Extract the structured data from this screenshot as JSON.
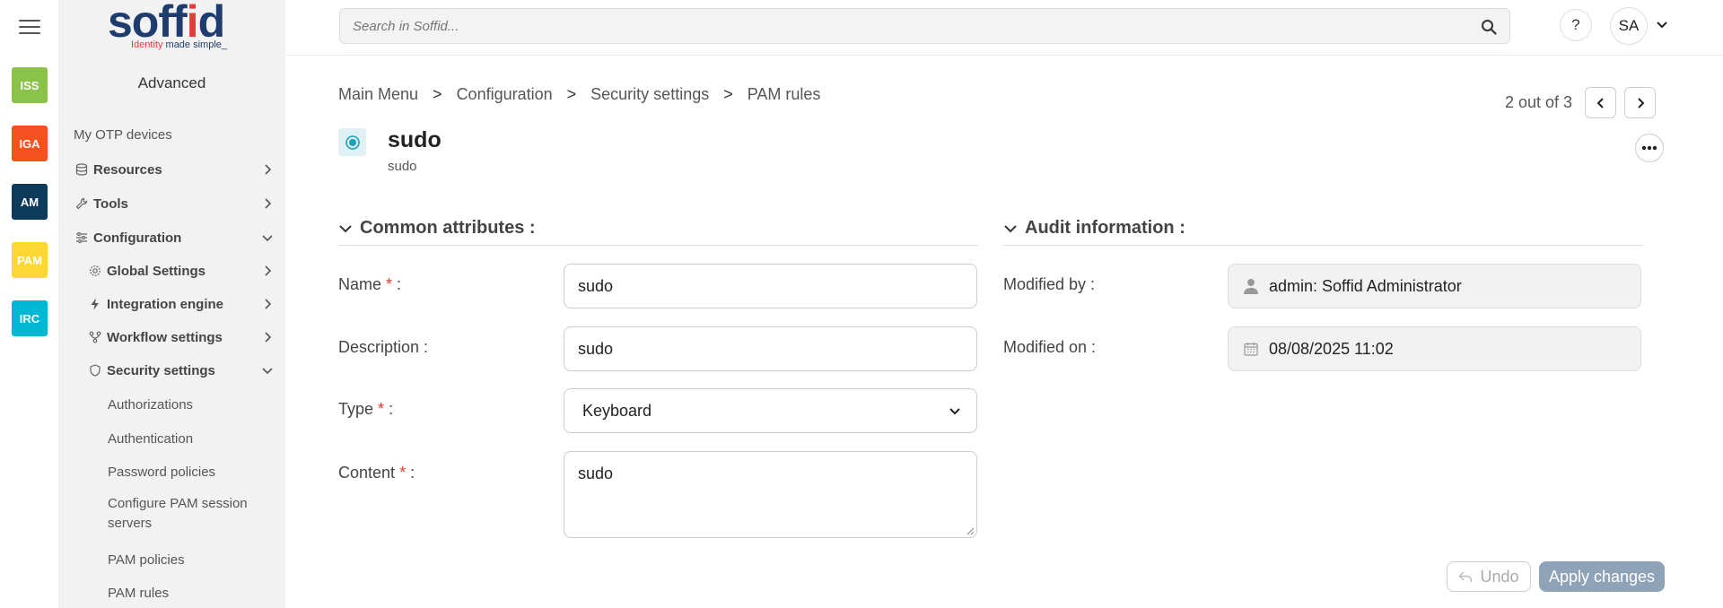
{
  "rail": {
    "tiles": [
      {
        "label": "ISS",
        "color": "#8bc34a"
      },
      {
        "label": "IGA",
        "color": "#f4511e"
      },
      {
        "label": "AM",
        "color": "#0d3b5e"
      },
      {
        "label": "PAM",
        "color": "#fdd835"
      },
      {
        "label": "IRC",
        "color": "#00b8d4"
      }
    ]
  },
  "logo": {
    "word_pre": "soff",
    "word_i": "i",
    "word_post": "d",
    "tag_pre": "Identity ",
    "tag_post": "made simple_"
  },
  "sidenav": {
    "section_title": "Advanced",
    "items": [
      {
        "label": "My OTP devices"
      },
      {
        "label": "Resources"
      },
      {
        "label": "Tools"
      },
      {
        "label": "Configuration"
      },
      {
        "label": "Global Settings"
      },
      {
        "label": "Integration engine"
      },
      {
        "label": "Workflow settings"
      },
      {
        "label": "Security settings"
      },
      {
        "label": "Authorizations"
      },
      {
        "label": "Authentication"
      },
      {
        "label": "Password policies"
      },
      {
        "label": "Configure PAM session servers"
      },
      {
        "label": "PAM policies"
      },
      {
        "label": "PAM rules"
      }
    ]
  },
  "topbar": {
    "search_placeholder": "Search in Soffid...",
    "help_label": "?",
    "avatar_initials": "SA"
  },
  "breadcrumb": {
    "items": [
      "Main Menu",
      "Configuration",
      "Security settings",
      "PAM rules"
    ],
    "separator": ">"
  },
  "pager": {
    "text": "2 out of 3"
  },
  "record": {
    "title": "sudo",
    "subtitle": "sudo"
  },
  "common": {
    "heading": "Common attributes :",
    "name_label": "Name",
    "name_value": "sudo",
    "description_label": "Description :",
    "description_value": "sudo",
    "type_label": "Type",
    "type_value": "Keyboard",
    "content_label": "Content",
    "content_value": "sudo",
    "required_mark": "*",
    "colon": " :"
  },
  "audit": {
    "heading": "Audit information :",
    "modified_by_label": "Modified by :",
    "modified_by_value": "admin: Soffid Administrator",
    "modified_on_label": "Modified on :",
    "modified_on_value": "08/08/2025 11:02"
  },
  "actions": {
    "undo_label": "Undo",
    "apply_label": "Apply changes"
  }
}
